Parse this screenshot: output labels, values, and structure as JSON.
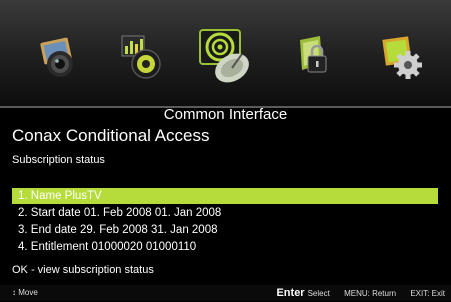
{
  "header": {
    "menu_icons": [
      {
        "name": "camera-lens-icon"
      },
      {
        "name": "audio-levels-icon"
      },
      {
        "name": "satellite-dish-icon"
      },
      {
        "name": "parental-lock-icon"
      },
      {
        "name": "settings-gear-icon"
      }
    ],
    "active_index": 2
  },
  "screen": {
    "section_title": "Common Interface",
    "module_title": "Conax Conditional Access",
    "subtitle": "Subscription status"
  },
  "subscription_items": [
    {
      "label": "1. Name  PlusTV",
      "selected": true
    },
    {
      "label": "2. Start date 01. Feb 2008   01. Jan 2008",
      "selected": false
    },
    {
      "label": "3. End date 29. Feb 2008   31. Jan 2008",
      "selected": false
    },
    {
      "label": "4. Entitlement 01000020   01000110",
      "selected": false
    }
  ],
  "hint": "OK - view subscription status",
  "footer": {
    "move_symbol": "↕",
    "move_label": "Move",
    "enter_key": "Enter",
    "enter_label": "Select",
    "menu_hint": "MENU: Return",
    "exit_hint": "EXIT: Exit"
  },
  "colors": {
    "highlight": "#b5dc3a",
    "background": "#000000"
  }
}
